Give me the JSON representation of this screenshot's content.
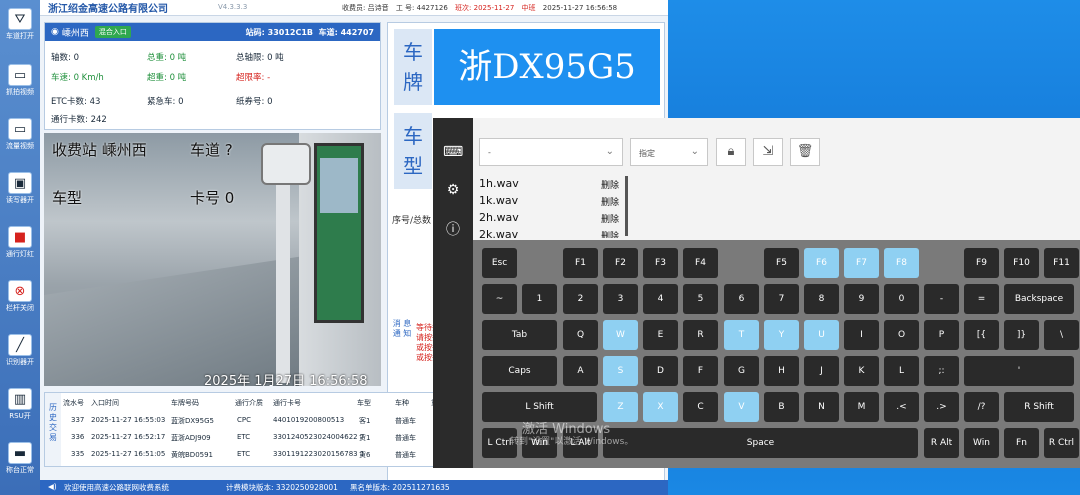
{
  "app": {
    "company": "浙江绍金高速公路有限公司",
    "version": "V4.3.3.3",
    "top_info": {
      "collector": "收费员: 吕诗音",
      "job_no": "工  号: 4427126",
      "shift": "班次: 2025-11-27",
      "shift_type": "中班",
      "datetime": "2025-11-27 16:56:58"
    }
  },
  "sidebar": {
    "items": [
      {
        "label": "车道打开",
        "icon": "lane-icon"
      },
      {
        "label": "抓拍视频",
        "icon": "camera-icon"
      },
      {
        "label": "流量视频",
        "icon": "flow-icon"
      },
      {
        "label": "读写器开",
        "icon": "reader-icon"
      },
      {
        "label": "通行灯红",
        "icon": "light-icon"
      },
      {
        "label": "栏杆关闭",
        "icon": "barrier-icon"
      },
      {
        "label": "识别器开",
        "icon": "recognizer-icon"
      },
      {
        "label": "RSU开",
        "icon": "rsu-icon"
      },
      {
        "label": "称台正常",
        "icon": "scale-icon"
      }
    ]
  },
  "info": {
    "station_name": "嵊州西",
    "mode_tag": "混合入口",
    "station_code": "站码: 33012C1B",
    "lane_code": "车道: 442707",
    "axle_count": "轴数: 0",
    "total_weight": "总重: 0 吨",
    "axle_limit": "总轴限: 0 吨",
    "speed": "车速: 0 Km/h",
    "overweight": "超重: 0 吨",
    "over_rate": "超限率: -",
    "etc_count": "ETC卡数: 43",
    "emergency": "紧急车: 0",
    "paper_ticket": "纸券号: 0",
    "pass_count": "通行卡数: 242"
  },
  "video": {
    "station_overlay": "收费站 嵊州西",
    "lane_overlay": "车道 ?",
    "type_overlay": "车型",
    "card_overlay": "卡号 0",
    "timestamp": "2025年 1月27日 16:56:58"
  },
  "plate": {
    "label": "车 牌",
    "value": "浙DX95G5",
    "type_label": "车 型",
    "seq_label": "序号/总数"
  },
  "notice": {
    "label": "消 息 通 知",
    "lines": [
      "等待扫",
      "请按扫",
      "或按扫",
      "或按扫"
    ]
  },
  "history": {
    "label": "历 史 交 易",
    "columns": [
      "流水号",
      "入口时间",
      "车牌号码",
      "通行介质",
      "通行卡号",
      "车型",
      "车种",
      "重"
    ],
    "rows": [
      [
        "337",
        "2025-11-27 16:55:03",
        "蓝浙DX95G5",
        "CPC",
        "4401019200800513",
        "客1",
        "普通车",
        ""
      ],
      [
        "336",
        "2025-11-27 16:52:17",
        "蓝浙ADJ909",
        "ETC",
        "3301240523024004622 7",
        "货1",
        "普通车",
        ""
      ],
      [
        "335",
        "2025-11-27 16:51:05",
        "黄皖BD0591",
        "ETC",
        "3301191223020156783 1",
        "货6",
        "普通车",
        ""
      ]
    ]
  },
  "status": {
    "welcome": "欢迎使用高速公路联网收费系统",
    "fee_version": "计费模块版本: 3320250928001",
    "blacklist_version": "黑名单版本: 202511271635"
  },
  "osk": {
    "dropdown1": "-",
    "dropdown2": "指定",
    "files": [
      {
        "name": "1h.wav",
        "action": "删除"
      },
      {
        "name": "1k.wav",
        "action": "删除"
      },
      {
        "name": "2h.wav",
        "action": "删除"
      },
      {
        "name": "2k.wav",
        "action": "删除"
      }
    ],
    "rows": [
      [
        "Esc",
        "F1",
        "F2",
        "F3",
        "F4",
        "F5",
        "F6",
        "F7",
        "F8",
        "F9",
        "F10",
        "F11"
      ],
      [
        "~",
        "1",
        "2",
        "3",
        "4",
        "5",
        "6",
        "7",
        "8",
        "9",
        "0",
        "-",
        "=",
        "Backspace"
      ],
      [
        "Tab",
        "Q",
        "W",
        "E",
        "R",
        "T",
        "Y",
        "U",
        "I",
        "O",
        "P",
        "[{",
        "]}",
        "\\"
      ],
      [
        "Caps",
        "A",
        "S",
        "D",
        "F",
        "G",
        "H",
        "J",
        "K",
        "L",
        ";:",
        "'",
        "Enter"
      ],
      [
        "L Shift",
        "Z",
        "X",
        "C",
        "V",
        "B",
        "N",
        "M",
        ".<",
        ".>",
        "/?",
        "R Shift"
      ],
      [
        "L Ctrl",
        "Win",
        "L Alt",
        "Space",
        "R Alt",
        "Win",
        "Fn",
        "R Ctrl"
      ]
    ],
    "highlighted": [
      "F6",
      "F7",
      "F8",
      "W",
      "T",
      "Y",
      "U",
      "S",
      "Z",
      "X",
      "V"
    ]
  },
  "watermark": {
    "line1": "激活 Windows",
    "line2": "转到\"设置\"以激活 Windows。"
  }
}
